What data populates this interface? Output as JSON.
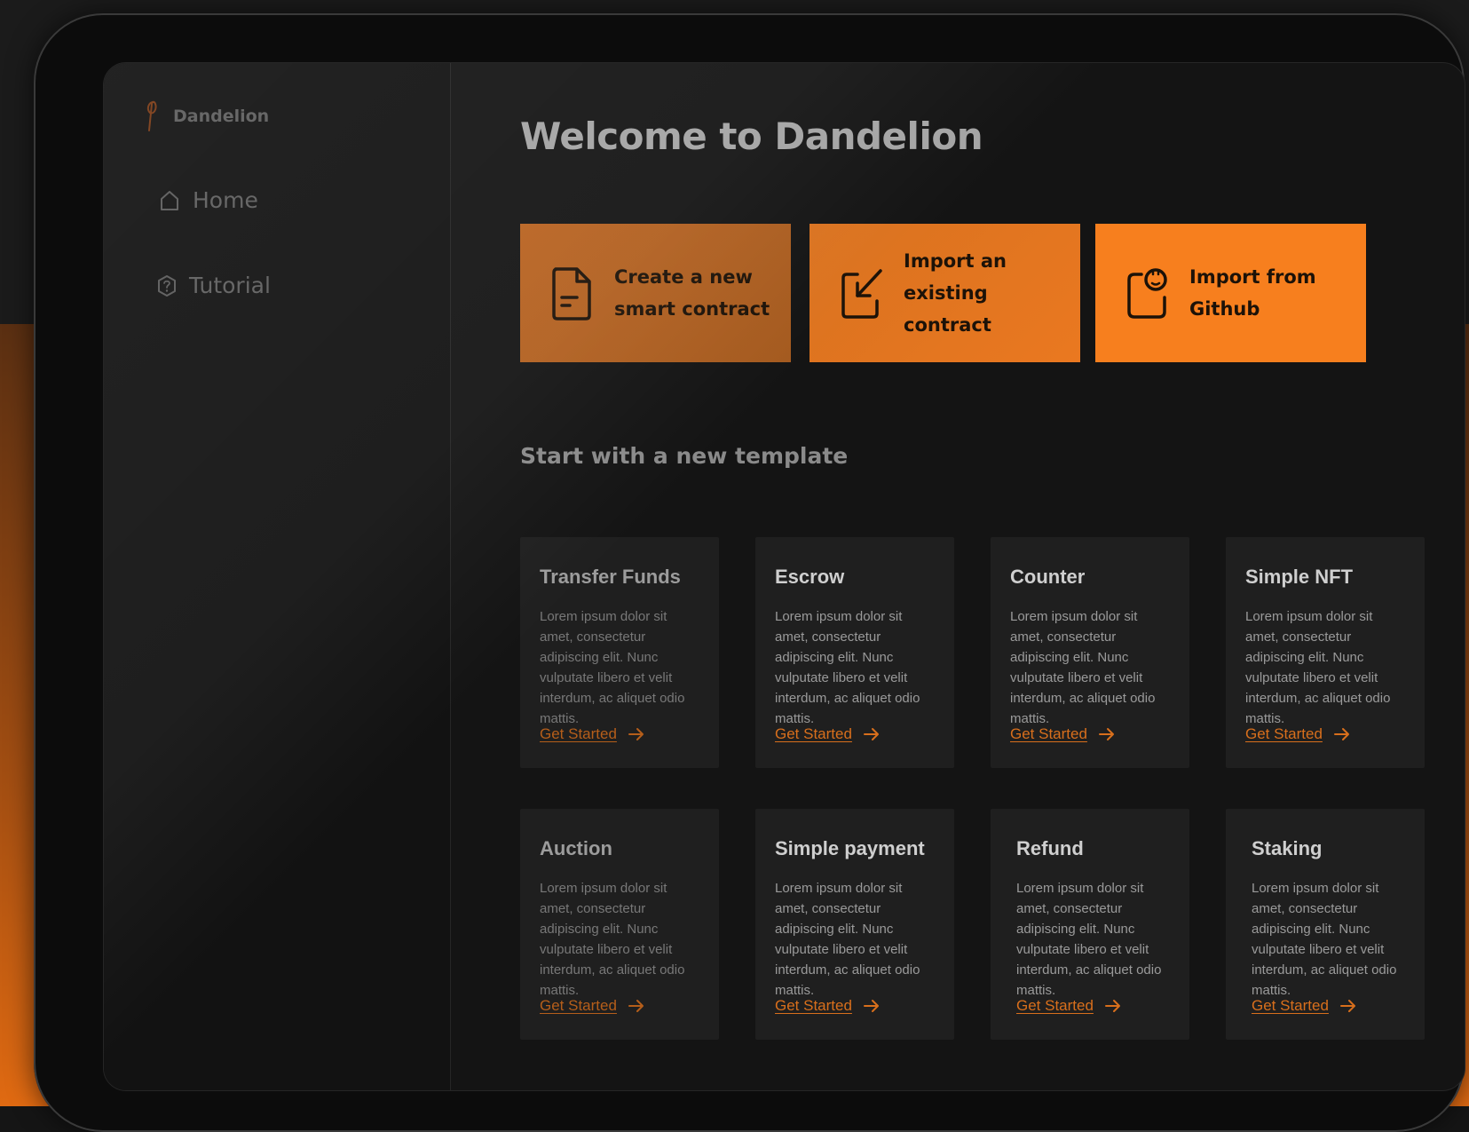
{
  "app": {
    "name": "Dandelion"
  },
  "sidebar": {
    "items": [
      {
        "label": "Home",
        "icon": "home-icon"
      },
      {
        "label": "Tutorial",
        "icon": "help-hexagon-icon"
      }
    ]
  },
  "main": {
    "title": "Welcome to Dandelion",
    "actions": [
      {
        "label": "Create a new smart contract",
        "icon": "document-icon"
      },
      {
        "label": "Import an existing contract",
        "icon": "import-arrow-icon"
      },
      {
        "label": "Import from Github",
        "icon": "github-icon"
      }
    ],
    "templates_title": "Start with a new template",
    "templates": [
      {
        "title": "Transfer Funds",
        "description": "Lorem ipsum dolor sit amet, consectetur adipiscing elit. Nunc vulputate libero et velit interdum, ac aliquet odio mattis.",
        "cta": "Get Started"
      },
      {
        "title": "Escrow",
        "description": "Lorem ipsum dolor sit amet, consectetur adipiscing elit. Nunc vulputate libero et velit interdum, ac aliquet odio mattis.",
        "cta": "Get Started"
      },
      {
        "title": "Counter",
        "description": "Lorem ipsum dolor sit amet, consectetur adipiscing elit. Nunc vulputate libero et velit interdum, ac aliquet odio mattis.",
        "cta": "Get Started"
      },
      {
        "title": "Simple NFT",
        "description": "Lorem ipsum dolor sit amet, consectetur adipiscing elit. Nunc vulputate libero et velit interdum, ac aliquet odio mattis.",
        "cta": "Get Started"
      },
      {
        "title": "Auction",
        "description": "Lorem ipsum dolor sit amet, consectetur adipiscing elit. Nunc vulputate libero et velit interdum, ac aliquet odio mattis.",
        "cta": "Get Started"
      },
      {
        "title": "Simple payment",
        "description": "Lorem ipsum dolor sit amet, consectetur adipiscing elit. Nunc vulputate libero et velit interdum, ac aliquet odio mattis.",
        "cta": "Get Started"
      },
      {
        "title": "Refund",
        "description": "Lorem ipsum dolor sit amet, consectetur adipiscing elit. Nunc vulputate libero et velit interdum, ac aliquet odio mattis.",
        "cta": "Get Started"
      },
      {
        "title": "Staking",
        "description": "Lorem ipsum dolor sit amet, consectetur adipiscing elit. Nunc vulputate libero et velit interdum, ac aliquet odio mattis.",
        "cta": "Get Started"
      }
    ]
  },
  "colors": {
    "accent": "#f47c1c",
    "link": "#d86f1c",
    "background": "#141414",
    "card": "#1f1f1f"
  }
}
